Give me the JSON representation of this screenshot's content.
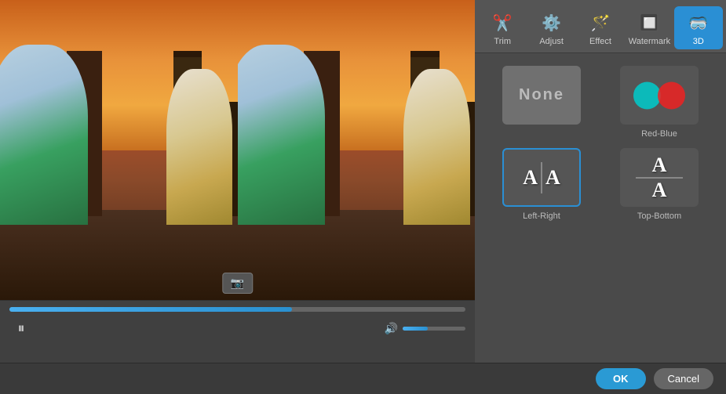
{
  "toolbar": {
    "items": [
      {
        "id": "trim",
        "label": "Trim",
        "icon": "✂",
        "active": false
      },
      {
        "id": "adjust",
        "label": "Adjust",
        "icon": "◑",
        "active": false
      },
      {
        "id": "effect",
        "label": "Effect",
        "icon": "✦",
        "active": false
      },
      {
        "id": "watermark",
        "label": "Watermark",
        "icon": "⊡",
        "active": false
      },
      {
        "id": "3d",
        "label": "3D",
        "icon": "◉",
        "active": true
      }
    ]
  },
  "options": [
    {
      "id": "none",
      "label": "None",
      "selected": false
    },
    {
      "id": "red-blue",
      "label": "Red-Blue",
      "selected": false
    },
    {
      "id": "left-right",
      "label": "Left-Right",
      "selected": true
    },
    {
      "id": "top-bottom",
      "label": "Top-Bottom",
      "selected": false
    }
  ],
  "controls": {
    "progress_percent": 62,
    "volume_percent": 40,
    "play_label": "⏸",
    "snapshot_label": "📷"
  },
  "footer": {
    "ok_label": "OK",
    "cancel_label": "Cancel"
  }
}
